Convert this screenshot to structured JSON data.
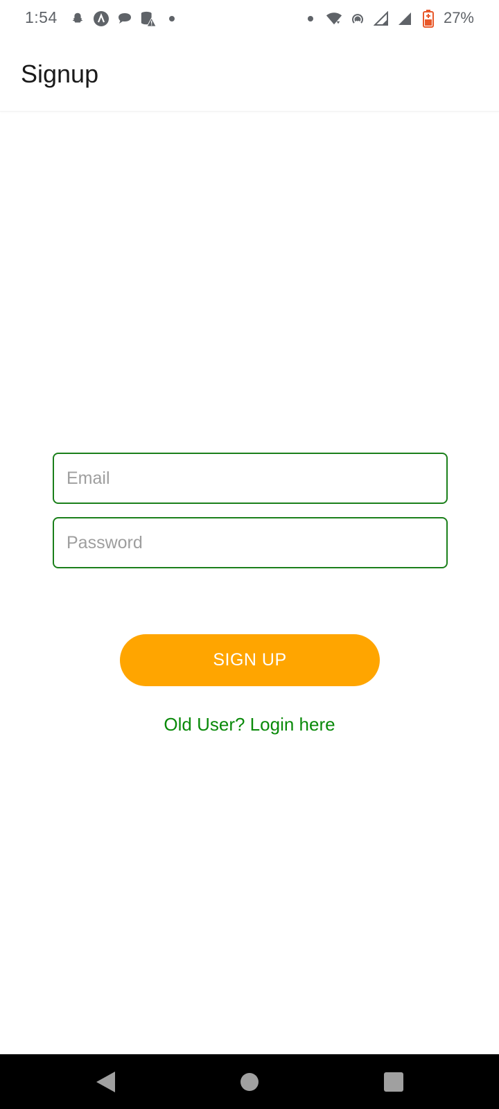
{
  "status_bar": {
    "time": "1:54",
    "battery_percent": "27%",
    "left_icons": [
      "snapchat-icon",
      "app-lambda-icon",
      "chat-bubble-icon",
      "database-warning-icon",
      "dot-icon"
    ],
    "right_icons": [
      "dot-icon",
      "wifi-icon",
      "hotspot-icon",
      "signal-icon",
      "signal-icon",
      "battery-icon"
    ]
  },
  "app_bar": {
    "title": "Signup"
  },
  "form": {
    "email_placeholder": "Email",
    "email_value": "",
    "password_placeholder": "Password",
    "password_value": "",
    "signup_label": "SIGN UP",
    "login_link_text": "Old User? Login here"
  },
  "colors": {
    "accent_button": "#ffa500",
    "field_border": "#1a7f1a",
    "link_text": "#0a8a0a"
  },
  "nav_bar": {
    "icons": [
      "back-icon",
      "home-icon",
      "recents-icon"
    ]
  }
}
